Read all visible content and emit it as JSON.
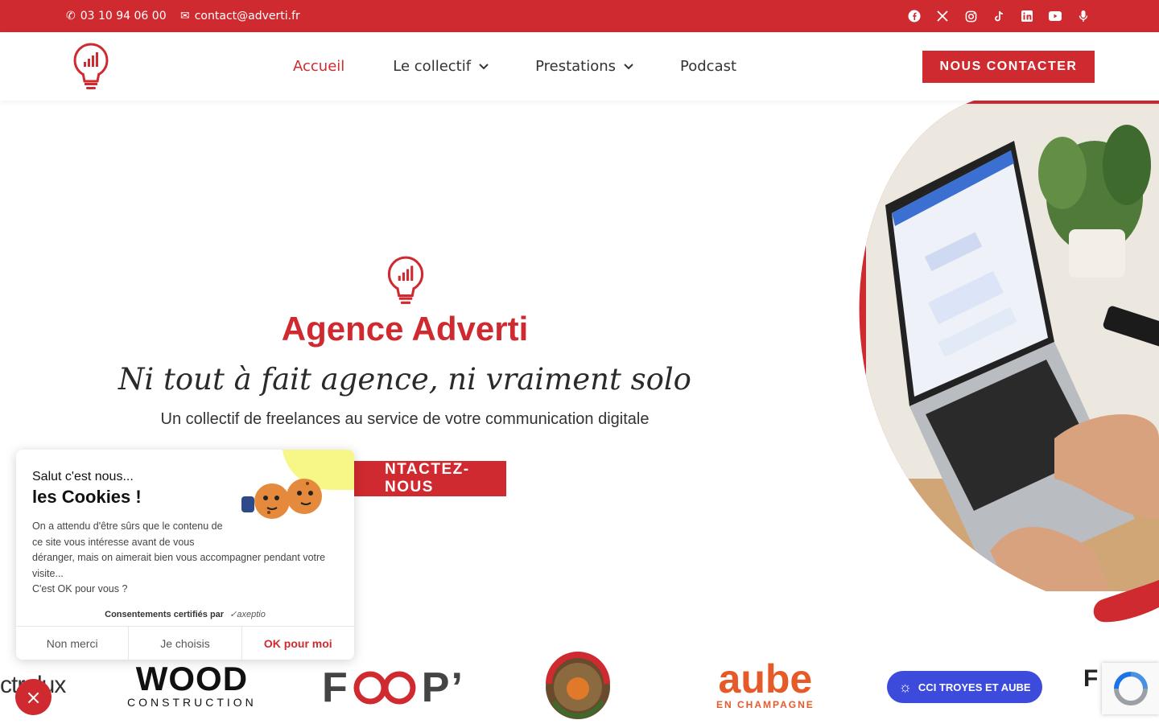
{
  "topbar": {
    "phone": "03 10 94 06 00",
    "email": "contact@adverti.fr",
    "phone_icon": "phone-icon",
    "email_icon": "envelope-icon",
    "socials": [
      "facebook-icon",
      "x-icon",
      "instagram-icon",
      "tiktok-icon",
      "linkedin-icon",
      "youtube-icon",
      "microphone-icon"
    ],
    "color": "#cf2a2f"
  },
  "header": {
    "nav": [
      {
        "label": "Accueil",
        "active": true
      },
      {
        "label": "Le collectif",
        "dropdown": true
      },
      {
        "label": "Prestations",
        "dropdown": true
      },
      {
        "label": "Podcast"
      }
    ],
    "cta": "NOUS CONTACTER"
  },
  "hero": {
    "title": "Agence Adverti",
    "tagline": "Ni tout à fait agence, ni vraiment solo",
    "subtitle": "Un collectif de freelances au service de votre communication digitale",
    "cta": "NTACTEZ-NOUS"
  },
  "logos": {
    "ctrolux": "ctrolux",
    "wood_main": "WOOD",
    "wood_sub": "CONSTRUCTION",
    "feep_a": "F",
    "feep_b": "P’",
    "champagne_alt": "Champagne Aventure",
    "aube_main": "aube",
    "aube_sub": "EN CHAMPAGNE",
    "cci": "CCI TROYES ET AUBE",
    "fr": "F"
  },
  "cookie": {
    "greeting": "Salut c'est nous...",
    "title": "les Cookies !",
    "body_line1": "On a attendu d'être sûrs que le contenu de ce site vous intéresse avant de vous",
    "body_line2": "déranger, mais on aimerait bien vous accompagner pendant votre visite...",
    "body_line3": "C'est OK pour vous ?",
    "certified": "Consentements certifiés par",
    "provider": "axeptio",
    "btn_refuse": "Non merci",
    "btn_choose": "Je choisis",
    "btn_accept": "OK pour moi"
  },
  "close_button": "×",
  "accent": "#cf2a2f"
}
